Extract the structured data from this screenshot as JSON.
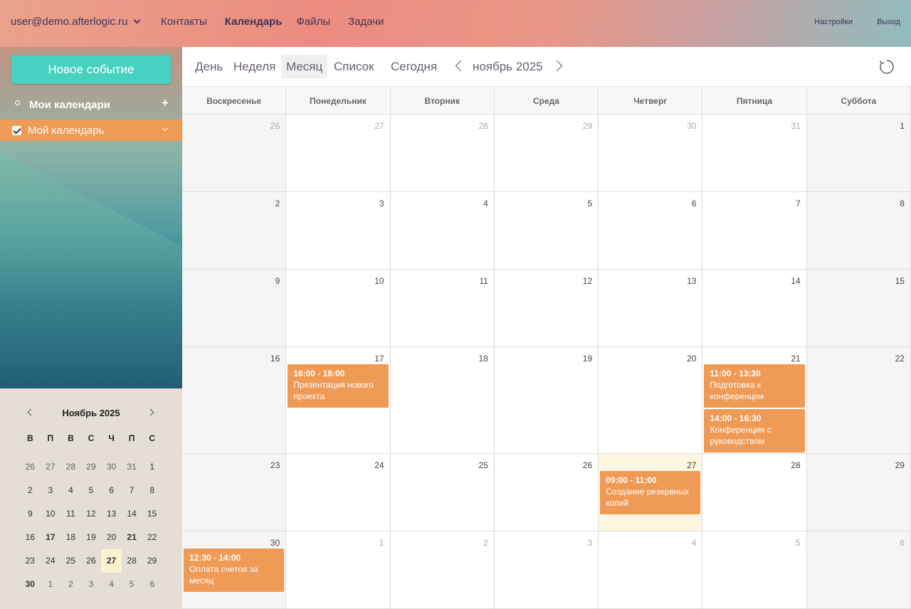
{
  "header": {
    "account": "user@demo.afterlogic.ru",
    "nav": [
      "Контакты",
      "Календарь",
      "Файлы",
      "Задачи"
    ],
    "active_nav": "Календарь",
    "settings": "Настройки",
    "logout": "Выход"
  },
  "sidebar": {
    "new_event": "Новое событие",
    "my_calendars": "Мои календари",
    "add_symbol": "+",
    "calendar_name": "Мой календарь",
    "calendar_color": "#ef9a55"
  },
  "mini_calendar": {
    "title": "Ноябрь 2025",
    "weekdays": [
      "В",
      "П",
      "В",
      "С",
      "Ч",
      "П",
      "С"
    ],
    "weeks": [
      [
        "26",
        "27",
        "28",
        "29",
        "30",
        "31",
        "1"
      ],
      [
        "2",
        "3",
        "4",
        "5",
        "6",
        "7",
        "8"
      ],
      [
        "9",
        "10",
        "11",
        "12",
        "13",
        "14",
        "15"
      ],
      [
        "16",
        "17",
        "18",
        "19",
        "20",
        "21",
        "22"
      ],
      [
        "23",
        "24",
        "25",
        "26",
        "27",
        "28",
        "29"
      ],
      [
        "30",
        "1",
        "2",
        "3",
        "4",
        "5",
        "6"
      ]
    ],
    "today": "27",
    "days_with_events": [
      "17",
      "21",
      "30"
    ]
  },
  "toolbar": {
    "views": [
      "День",
      "Неделя",
      "Месяц",
      "Список"
    ],
    "active_view": "Месяц",
    "today": "Сегодня",
    "period": "ноябрь 2025"
  },
  "month": {
    "weekdays": [
      "Воскресенье",
      "Понедельник",
      "Вторник",
      "Среда",
      "Четверг",
      "Пятница",
      "Суббота"
    ],
    "weeks": [
      [
        "26",
        "27",
        "28",
        "29",
        "30",
        "31",
        "1"
      ],
      [
        "2",
        "3",
        "4",
        "5",
        "6",
        "7",
        "8"
      ],
      [
        "9",
        "10",
        "11",
        "12",
        "13",
        "14",
        "15"
      ],
      [
        "16",
        "17",
        "18",
        "19",
        "20",
        "21",
        "22"
      ],
      [
        "23",
        "24",
        "25",
        "26",
        "27",
        "28",
        "29"
      ],
      [
        "30",
        "1",
        "2",
        "3",
        "4",
        "5",
        "6"
      ]
    ],
    "today_cell": "27",
    "events": [
      {
        "week": 3,
        "day": 1,
        "slot": 0,
        "time": "16:00 - 18:00",
        "title": "Презентация нового проекта"
      },
      {
        "week": 3,
        "day": 5,
        "slot": 0,
        "time": "11:00 - 13:30",
        "title": "Подготовка к конференции"
      },
      {
        "week": 3,
        "day": 5,
        "slot": 1,
        "time": "14:00 - 16:30",
        "title": "Конференция с руководством"
      },
      {
        "week": 4,
        "day": 4,
        "slot": 0,
        "time": "09:00 - 11:00",
        "title": "Создание резервных копий"
      },
      {
        "week": 5,
        "day": 0,
        "slot": 0,
        "time": "12:30 - 14:00",
        "title": "Оплата счетов за месяц"
      }
    ]
  }
}
